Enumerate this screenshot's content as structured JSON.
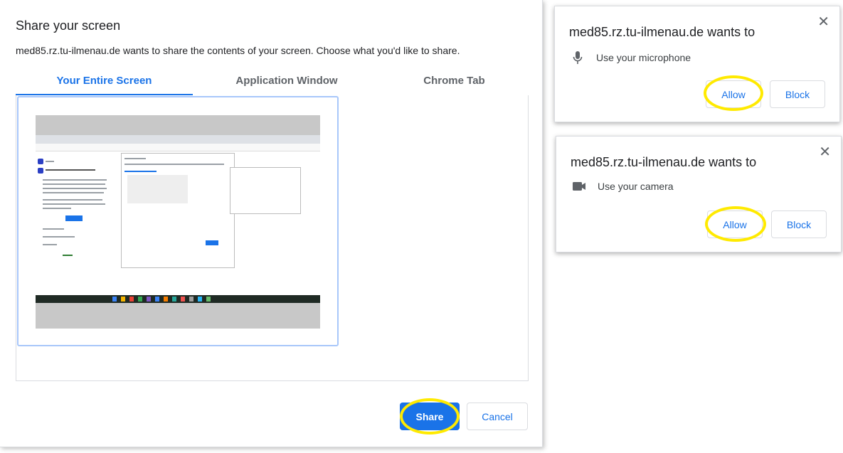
{
  "share_dialog": {
    "title": "Share your screen",
    "description": "med85.rz.tu-ilmenau.de wants to share the contents of your screen. Choose what you'd like to share.",
    "tabs": [
      {
        "label": "Your Entire Screen",
        "active": true
      },
      {
        "label": "Application Window",
        "active": false
      },
      {
        "label": "Chrome Tab",
        "active": false
      }
    ],
    "share_label": "Share",
    "cancel_label": "Cancel"
  },
  "popups": {
    "microphone": {
      "title": "med85.rz.tu-ilmenau.de wants to",
      "permission": "Use your microphone",
      "icon": "microphone-icon",
      "allow_label": "Allow",
      "block_label": "Block",
      "close_glyph": "✕"
    },
    "camera": {
      "title": "med85.rz.tu-ilmenau.de wants to",
      "permission": "Use your camera",
      "icon": "camera-icon",
      "allow_label": "Allow",
      "block_label": "Block",
      "close_glyph": "✕"
    }
  },
  "colors": {
    "accent": "#1a73e8",
    "highlight": "#ffea00"
  }
}
